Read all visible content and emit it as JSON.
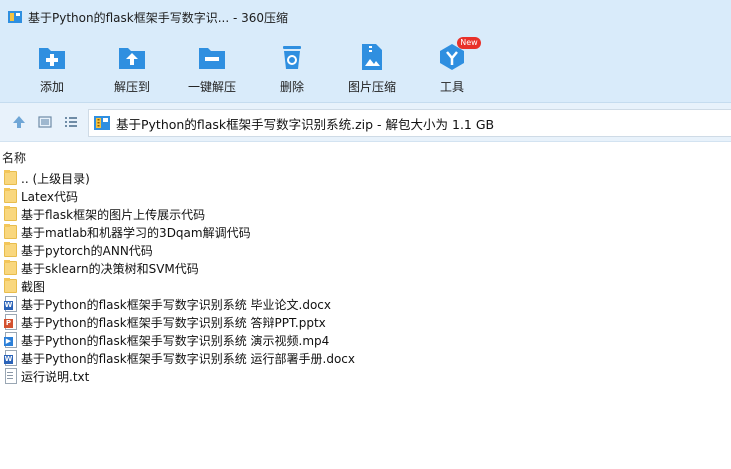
{
  "window": {
    "title": "基于Python的flask框架手写数字识... - 360压缩"
  },
  "toolbar": {
    "add": "添加",
    "extract_to": "解压到",
    "one_click_extract": "一键解压",
    "delete": "删除",
    "image_compress": "图片压缩",
    "tools": "工具",
    "new_badge": "New"
  },
  "address": {
    "path": "基于Python的flask框架手写数字识别系统.zip - 解包大小为 1.1 GB"
  },
  "list": {
    "column_name": "名称",
    "items": [
      {
        "name": ".. (上级目录)",
        "type": "folder"
      },
      {
        "name": "Latex代码",
        "type": "folder"
      },
      {
        "name": "基于flask框架的图片上传展示代码",
        "type": "folder"
      },
      {
        "name": "基于matlab和机器学习的3Dqam解调代码",
        "type": "folder"
      },
      {
        "name": "基于pytorch的ANN代码",
        "type": "folder"
      },
      {
        "name": "基于sklearn的决策树和SVM代码",
        "type": "folder"
      },
      {
        "name": "截图",
        "type": "folder"
      },
      {
        "name": "基于Python的flask框架手写数字识别系统 毕业论文.docx",
        "type": "docx"
      },
      {
        "name": "基于Python的flask框架手写数字识别系统 答辩PPT.pptx",
        "type": "pptx"
      },
      {
        "name": "基于Python的flask框架手写数字识别系统 演示视频.mp4",
        "type": "mp4"
      },
      {
        "name": "基于Python的flask框架手写数字识别系统 运行部署手册.docx",
        "type": "docx"
      },
      {
        "name": "运行说明.txt",
        "type": "txt"
      }
    ]
  },
  "colors": {
    "titlebar_bg": "#d9ebfa",
    "icon_blue": "#2f8fe0",
    "new_badge": "#e8312a",
    "folder": "#f9d77e"
  }
}
